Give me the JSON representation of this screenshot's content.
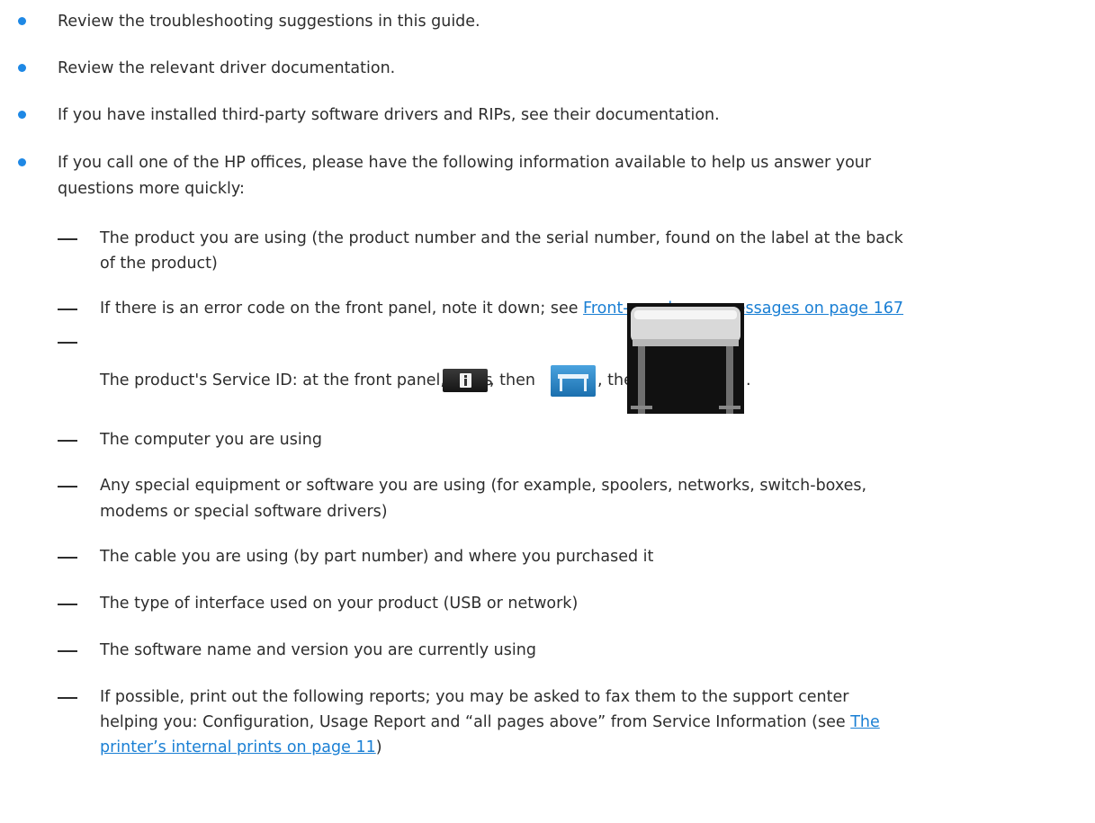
{
  "items": [
    {
      "text": "Review the troubleshooting suggestions in this guide."
    },
    {
      "text": "Review the relevant driver documentation."
    },
    {
      "text": "If you have installed third-party software drivers and RIPs, see their documentation."
    },
    {
      "text_line1": "If you call one of the HP offices, please have the following information available to help us answer your",
      "text_line2": "questions more quickly:"
    }
  ],
  "subitems": {
    "product": {
      "line1": "The product you are using (the product number and the serial number, found on the label at the back",
      "line2": "of the product)"
    },
    "error_code": {
      "prefix": "If there is an error code on the front panel, note it down; see ",
      "link": "Front-panel error messages on page 167"
    },
    "service_id": {
      "prefix": "The product's Service ID: at the front panel, press ",
      "then1": ", then ",
      "then2": ", then ",
      "end": "."
    },
    "computer": "The computer you are using",
    "equipment": {
      "line1": "Any special equipment or software you are using (for example, spoolers, networks, switch-boxes,",
      "line2": "modems or special software drivers)"
    },
    "cable": "The cable you are using (by part number) and where you purchased it",
    "interface": "The type of interface used on your product (USB or network)",
    "software": "The software name and version you are currently using",
    "reports": {
      "line1": "If possible, print out the following reports; you may be asked to fax them to the support center",
      "line2": "helping you: Configuration, Usage Report and “all pages above” from Service Information (see ",
      "link_part1": "The",
      "link_part2": "printer’s internal prints on page 11",
      "end": ")"
    }
  },
  "icons": [
    "info-icon",
    "printer-icon",
    "printer-photo-icon"
  ]
}
